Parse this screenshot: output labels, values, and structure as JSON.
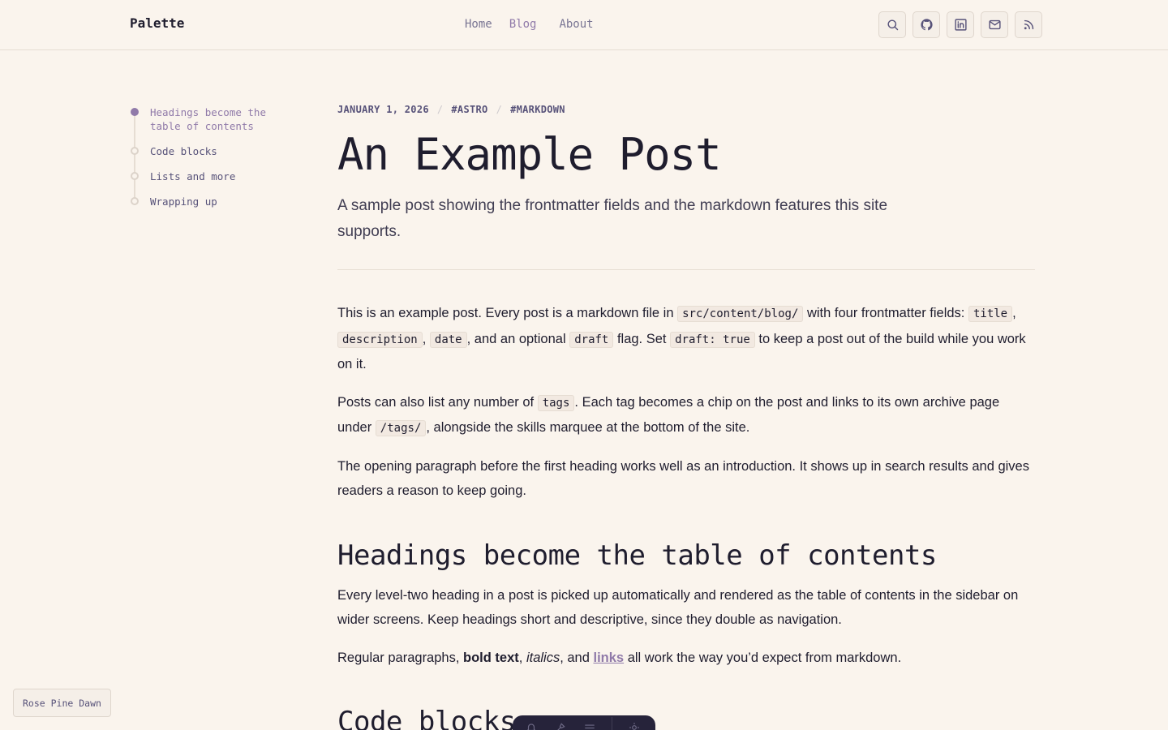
{
  "header": {
    "brand": "Palette",
    "nav": [
      {
        "label": "Home",
        "active": false
      },
      {
        "label": "Blog",
        "active": true
      },
      {
        "label": "About",
        "active": false
      }
    ],
    "icons": [
      "search-icon",
      "github-icon",
      "linkedin-icon",
      "mail-icon",
      "rss-icon"
    ]
  },
  "toc": {
    "items": [
      {
        "label": "Headings become the table of contents",
        "active": true
      },
      {
        "label": "Code blocks",
        "active": false
      },
      {
        "label": "Lists and more",
        "active": false
      },
      {
        "label": "Wrapping up",
        "active": false
      }
    ]
  },
  "post": {
    "date": "JANUARY 1, 2026",
    "separator": "/",
    "tags": [
      "#ASTRO",
      "#MARKDOWN"
    ],
    "title": "An Example Post",
    "description": "A sample post showing the frontmatter fields and the markdown features this site supports.",
    "p1": {
      "t1": "This is an example post. Every post is a markdown file in ",
      "c1": "src/content/blog/",
      "t2": " with four frontmatter fields: ",
      "c2": "title",
      "t3": ", ",
      "c3": "description",
      "t4": ", ",
      "c4": "date",
      "t5": ", and an optional ",
      "c5": "draft",
      "t6": " flag. Set ",
      "c6": "draft: true",
      "t7": " to keep a post out of the build while you work on it."
    },
    "p2": {
      "t1": "Posts can also list any number of ",
      "c1": "tags",
      "t2": ". Each tag becomes a chip on the post and links to its own archive page under ",
      "c2": "/tags/",
      "t3": ", alongside the skills marquee at the bottom of the site."
    },
    "p3": "The opening paragraph before the first heading works well as an introduction. It shows up in search results and gives readers a reason to keep going.",
    "h2_1": "Headings become the table of contents",
    "p4": "Every level-two heading in a post is picked up automatically and rendered as the table of contents in the sidebar on wider screens. Keep headings short and descriptive, since they double as navigation.",
    "p5": {
      "t1": "Regular paragraphs, ",
      "bold": "bold text",
      "t2": ", ",
      "italic": "italics",
      "t3": ", and ",
      "link": "links",
      "t4": " all work the way you’d expect from markdown."
    },
    "h2_2": "Code blocks"
  },
  "theme": {
    "label": "Rose Pine Dawn"
  },
  "colors": {
    "background": "#faf4ed",
    "accent": "#907aa9",
    "text": "#1f1d2e",
    "muted": "#797593"
  }
}
